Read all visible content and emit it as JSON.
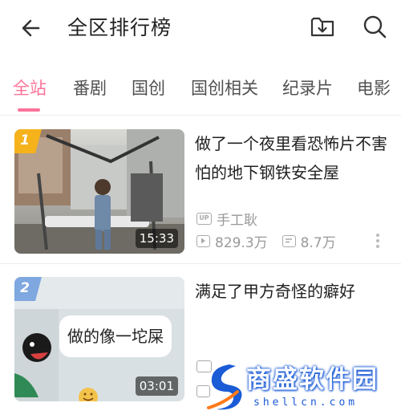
{
  "header": {
    "title": "全区排行榜"
  },
  "tabs": [
    {
      "label": "全站",
      "active": true
    },
    {
      "label": "番剧",
      "active": false
    },
    {
      "label": "国创",
      "active": false
    },
    {
      "label": "国创相关",
      "active": false
    },
    {
      "label": "纪录片",
      "active": false
    },
    {
      "label": "电影",
      "active": false
    }
  ],
  "videos": [
    {
      "rank": "1",
      "title_line1": "做了一个夜里看恐怖片不害",
      "title_line2": "怕的地下钢铁安全屋",
      "duration": "15:33",
      "up_badge": "UP",
      "up_name": "手工耿",
      "views": "829.3万",
      "danmaku": "8.7万"
    },
    {
      "rank": "2",
      "title_line1": "满足了甲方奇怪的癖好",
      "duration": "03:01",
      "thumb_caption": "做的像一坨屎"
    }
  ],
  "colors": {
    "accent": "#fb7299",
    "rank1": "#f5b21b",
    "rank2": "#7fa7e0",
    "watermark": "#1a5bd6"
  },
  "watermark": {
    "text": "商盛软件园",
    "sub": "shellcn.com"
  }
}
